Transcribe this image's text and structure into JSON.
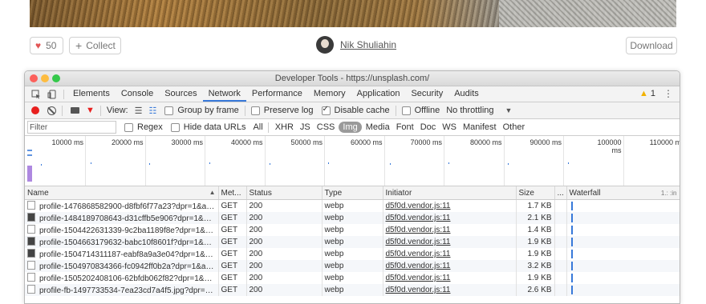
{
  "photo_page": {
    "likes_count": "50",
    "collect_label": "Collect",
    "author_name": "Nik Shuliahin",
    "download_label": "Download"
  },
  "devtools": {
    "window_title": "Developer Tools - https://unsplash.com/",
    "tabs": [
      "Elements",
      "Console",
      "Sources",
      "Network",
      "Performance",
      "Memory",
      "Application",
      "Security",
      "Audits"
    ],
    "active_tab": "Network",
    "warning_count": "1",
    "toolbar": {
      "view_label": "View:",
      "group_by_frame": "Group by frame",
      "preserve_log": "Preserve log",
      "disable_cache": "Disable cache",
      "offline": "Offline",
      "throttling": "No throttling"
    },
    "filter": {
      "placeholder": "Filter",
      "regex": "Regex",
      "hide_data_urls": "Hide data URLs",
      "types": [
        "All",
        "XHR",
        "JS",
        "CSS",
        "Img",
        "Media",
        "Font",
        "Doc",
        "WS",
        "Manifest",
        "Other"
      ],
      "active_type": "Img"
    },
    "overview_ticks": [
      "10000 ms",
      "20000 ms",
      "30000 ms",
      "40000 ms",
      "50000 ms",
      "60000 ms",
      "70000 ms",
      "80000 ms",
      "90000 ms",
      "100000 ms",
      "110000 m"
    ],
    "columns": {
      "name": "Name",
      "method": "Met...",
      "status": "Status",
      "type": "Type",
      "initiator": "Initiator",
      "size": "Size",
      "more": "...",
      "waterfall": "Waterfall",
      "waterfall_extra": "1.: :in"
    },
    "rows": [
      {
        "name": "profile-1476868582900-d8fbf6f77a23?dpr=1&auto=...",
        "method": "GET",
        "status": "200",
        "type": "webp",
        "initiator": "d5f0d.vendor.js:11",
        "size": "1.7 KB",
        "dark": false
      },
      {
        "name": "profile-1484189708643-d31cffb5e906?dpr=1&auto=...",
        "method": "GET",
        "status": "200",
        "type": "webp",
        "initiator": "d5f0d.vendor.js:11",
        "size": "2.1 KB",
        "dark": true
      },
      {
        "name": "profile-1504422631339-9c2ba1189f8e?dpr=1&auto=...",
        "method": "GET",
        "status": "200",
        "type": "webp",
        "initiator": "d5f0d.vendor.js:11",
        "size": "1.4 KB",
        "dark": false
      },
      {
        "name": "profile-1504663179632-babc10f8601f?dpr=1&auto=...",
        "method": "GET",
        "status": "200",
        "type": "webp",
        "initiator": "d5f0d.vendor.js:11",
        "size": "1.9 KB",
        "dark": true
      },
      {
        "name": "profile-1504714311187-eabf8a9a3e04?dpr=1&auto=...",
        "method": "GET",
        "status": "200",
        "type": "webp",
        "initiator": "d5f0d.vendor.js:11",
        "size": "1.9 KB",
        "dark": true
      },
      {
        "name": "profile-1504970834366-fc0942ff0b2a?dpr=1&auto=...",
        "method": "GET",
        "status": "200",
        "type": "webp",
        "initiator": "d5f0d.vendor.js:11",
        "size": "3.2 KB",
        "dark": false
      },
      {
        "name": "profile-1505202408106-62bfdb062f82?dpr=1&auto=...",
        "method": "GET",
        "status": "200",
        "type": "webp",
        "initiator": "d5f0d.vendor.js:11",
        "size": "1.9 KB",
        "dark": false
      },
      {
        "name": "profile-fb-1497733534-7ea23cd7a4f5.jpg?dpr=1&au...",
        "method": "GET",
        "status": "200",
        "type": "webp",
        "initiator": "d5f0d.vendor.js:11",
        "size": "2.6 KB",
        "dark": false
      }
    ]
  }
}
